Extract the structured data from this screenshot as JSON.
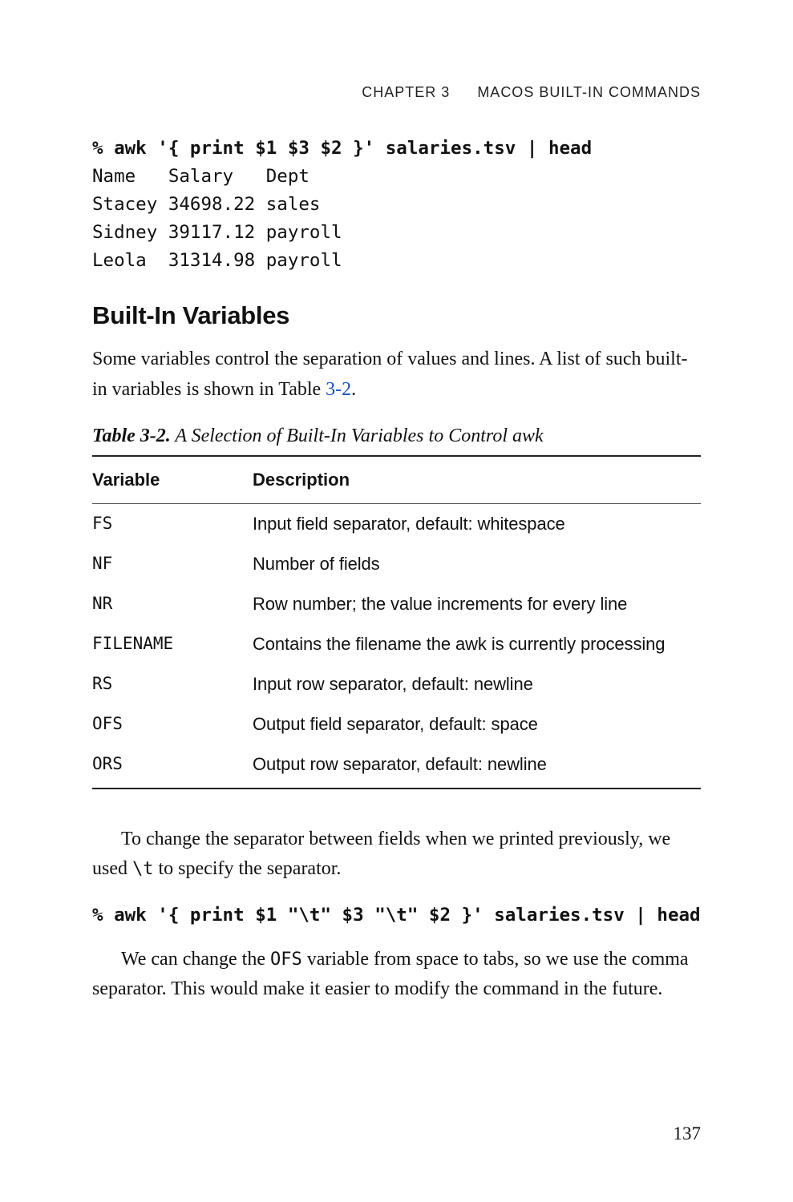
{
  "header": {
    "chapter": "CHAPTER 3",
    "title": "MACOS BUILT-IN COMMANDS"
  },
  "code1": {
    "cmd": "% awk '{ print $1 $3 $2 }' salaries.tsv | head",
    "out": "Name   Salary   Dept\nStacey 34698.22 sales\nSidney 39117.12 payroll\nLeola  31314.98 payroll"
  },
  "section_heading": "Built-In Variables",
  "para1_a": "Some variables control the separation of values and lines. A list of such built-in variables is shown in Table ",
  "para1_link": "3-2",
  "para1_b": ".",
  "table": {
    "caption_label": "Table 3-2.",
    "caption_text": "  A Selection of Built-In Variables to Control awk",
    "head_var": "Variable",
    "head_desc": "Description",
    "rows": [
      {
        "var": "FS",
        "desc": "Input field separator, default: whitespace"
      },
      {
        "var": "NF",
        "desc": "Number of fields"
      },
      {
        "var": "NR",
        "desc": "Row number; the value increments for every line"
      },
      {
        "var": "FILENAME",
        "desc": "Contains the filename the awk is currently processing"
      },
      {
        "var": "RS",
        "desc": "Input row separator, default: newline"
      },
      {
        "var": "OFS",
        "desc": "Output field separator, default: space"
      },
      {
        "var": "ORS",
        "desc": "Output row separator, default: newline"
      }
    ]
  },
  "para2_a": "To change the separator between fields when we printed previously, we used ",
  "para2_mono": "\\t",
  "para2_b": " to specify the separator.",
  "code2": "% awk '{ print $1 \"\\t\" $3 \"\\t\" $2 }' salaries.tsv | head",
  "para3_a": "We can change the ",
  "para3_mono": "OFS",
  "para3_b": " variable from space to tabs, so we use the comma separator. This would make it easier to modify the command in the future.",
  "page_number": "137",
  "chart_data": {
    "type": "table",
    "title": "Table 3-2. A Selection of Built-In Variables to Control awk",
    "columns": [
      "Variable",
      "Description"
    ],
    "rows": [
      [
        "FS",
        "Input field separator, default: whitespace"
      ],
      [
        "NF",
        "Number of fields"
      ],
      [
        "NR",
        "Row number; the value increments for every line"
      ],
      [
        "FILENAME",
        "Contains the filename the awk is currently processing"
      ],
      [
        "RS",
        "Input row separator, default: newline"
      ],
      [
        "OFS",
        "Output field separator, default: space"
      ],
      [
        "ORS",
        "Output row separator, default: newline"
      ]
    ]
  }
}
